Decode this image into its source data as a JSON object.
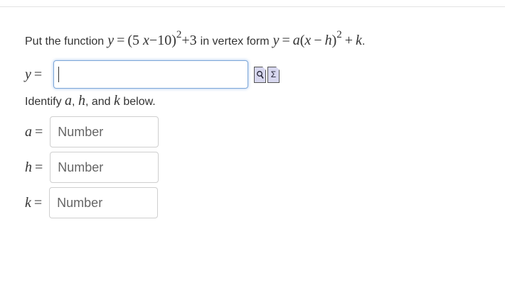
{
  "question": {
    "prefix": "Put the function",
    "function_y": "y",
    "equals": "=",
    "function_body": "(5",
    "function_x": "x",
    "function_rest": "−10)",
    "function_exp": "2",
    "function_tail": "+3",
    "middle": "in vertex form",
    "vertex_y": "y",
    "vertex_a": "a",
    "vertex_open": "(",
    "vertex_x": "x",
    "vertex_minus": "−",
    "vertex_h": "h",
    "vertex_close": ")",
    "vertex_exp": "2",
    "vertex_plus": "+",
    "vertex_k": "k",
    "period": "."
  },
  "answer": {
    "lhs_var": "y",
    "equals": "=",
    "value": ""
  },
  "tools": [
    {
      "name": "preview-icon",
      "glyph": "🔍"
    },
    {
      "name": "sigma-icon",
      "glyph": "Σ"
    }
  ],
  "identify": {
    "prefix": "Identify",
    "a": "a",
    "comma1": ",",
    "h": "h",
    "and_text": ", and",
    "k": "k",
    "suffix": "below."
  },
  "fields": [
    {
      "var": "a",
      "equals": "=",
      "placeholder": "Number"
    },
    {
      "var": "h",
      "equals": "=",
      "placeholder": "Number"
    },
    {
      "var": "k",
      "equals": "=",
      "placeholder": "Number"
    }
  ]
}
